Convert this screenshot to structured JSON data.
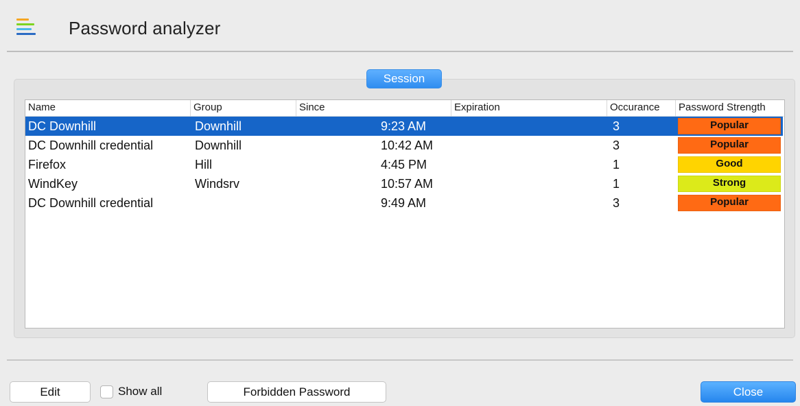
{
  "window": {
    "title": "Password analyzer"
  },
  "logo": {
    "icon": "stacked-bars-logo-icon",
    "colors": [
      "#f5a623",
      "#7ed321",
      "#4ab8e8",
      "#2b6cc4"
    ]
  },
  "session": {
    "label": "Session"
  },
  "table": {
    "columns": [
      "Name",
      "Group",
      "Since",
      "Expiration",
      "Occurance",
      "Password Strength"
    ],
    "rows": [
      {
        "name": "DC Downhill",
        "group": "Downhill",
        "since": "9:23 AM",
        "expiration": "",
        "occurance": "3",
        "strength": "Popular",
        "strength_color": "#ff6a14",
        "selected": true
      },
      {
        "name": "DC Downhill credential",
        "group": "Downhill",
        "since": "10:42 AM",
        "expiration": "",
        "occurance": "3",
        "strength": "Popular",
        "strength_color": "#ff6a14",
        "selected": false
      },
      {
        "name": "Firefox",
        "group": "Hill",
        "since": "4:45 PM",
        "expiration": "",
        "occurance": "1",
        "strength": "Good",
        "strength_color": "#ffd400",
        "selected": false
      },
      {
        "name": "WindKey",
        "group": "Windsrv",
        "since": "10:57 AM",
        "expiration": "",
        "occurance": "1",
        "strength": "Strong",
        "strength_color": "#dcea1a",
        "selected": false
      },
      {
        "name": "DC Downhill credential",
        "group": "",
        "since": "9:49 AM",
        "expiration": "",
        "occurance": "3",
        "strength": "Popular",
        "strength_color": "#ff6a14",
        "selected": false
      }
    ]
  },
  "footer": {
    "edit_label": "Edit",
    "show_all_label": "Show all",
    "show_all_checked": false,
    "forbidden_label": "Forbidden Password",
    "close_label": "Close"
  },
  "colors": {
    "accent": "#2f8df0",
    "selection": "#1665c8"
  }
}
